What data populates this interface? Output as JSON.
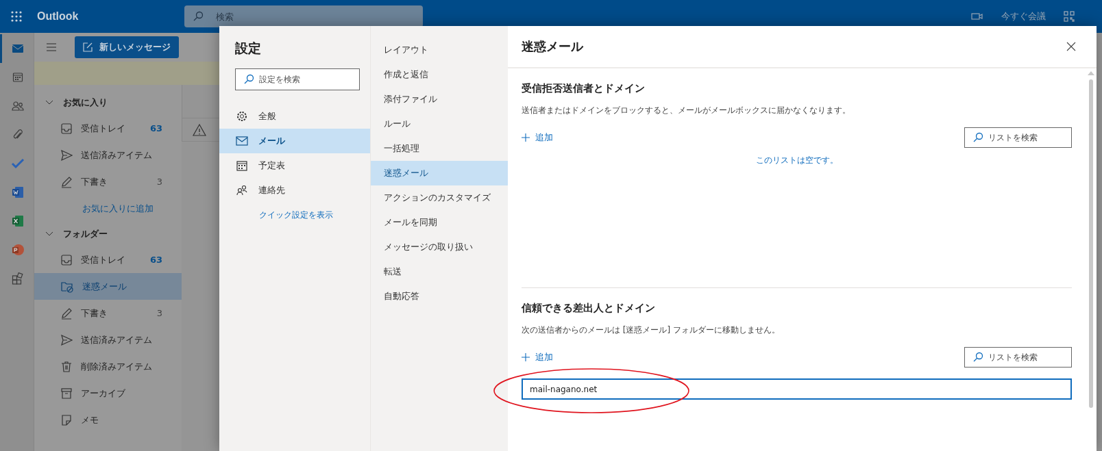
{
  "topbar": {
    "app_name": "Outlook",
    "search_placeholder": "検索",
    "meet_now": "今すぐ会議"
  },
  "rail": [
    {
      "kind": "mail",
      "selected": true
    },
    {
      "kind": "calendar",
      "selected": false
    },
    {
      "kind": "people",
      "selected": false
    },
    {
      "kind": "attach",
      "selected": false
    },
    {
      "kind": "todo",
      "selected": false
    },
    {
      "kind": "word",
      "selected": false
    },
    {
      "kind": "excel",
      "selected": false
    },
    {
      "kind": "powerpoint",
      "selected": false
    },
    {
      "kind": "apps",
      "selected": false
    }
  ],
  "new_message": "新しいメッセージ",
  "folder_groups": [
    {
      "title": "お気に入り",
      "expanded": true,
      "items": [
        {
          "kind": "inbox",
          "label": "受信トレイ",
          "count": "63",
          "unread": true,
          "selected": false
        },
        {
          "kind": "sent",
          "label": "送信済みアイテム",
          "selected": false
        },
        {
          "kind": "drafts",
          "label": "下書き",
          "count": "3",
          "unread": false,
          "selected": false
        },
        {
          "kind": "link",
          "label": "お気に入りに追加",
          "selected": false
        }
      ]
    },
    {
      "title": "フォルダー",
      "expanded": true,
      "items": [
        {
          "kind": "inbox",
          "label": "受信トレイ",
          "count": "63",
          "unread": true,
          "selected": false
        },
        {
          "kind": "junk",
          "label": "迷惑メール",
          "selected": true
        },
        {
          "kind": "drafts",
          "label": "下書き",
          "count": "3",
          "unread": false,
          "selected": false
        },
        {
          "kind": "sent",
          "label": "送信済みアイテム",
          "selected": false
        },
        {
          "kind": "deleted",
          "label": "削除済みアイテム",
          "selected": false
        },
        {
          "kind": "archive",
          "label": "アーカイブ",
          "selected": false
        },
        {
          "kind": "notes",
          "label": "メモ",
          "selected": false
        }
      ]
    }
  ],
  "settings": {
    "title": "設定",
    "search_placeholder": "設定を検索",
    "categories": [
      {
        "kind": "general",
        "label": "全般",
        "selected": false
      },
      {
        "kind": "mail",
        "label": "メール",
        "selected": true
      },
      {
        "kind": "calendar",
        "label": "予定表",
        "selected": false
      },
      {
        "kind": "people",
        "label": "連絡先",
        "selected": false
      }
    ],
    "quick_settings_link": "クイック設定を表示",
    "subcategories": [
      {
        "label": "レイアウト",
        "selected": false
      },
      {
        "label": "作成と返信",
        "selected": false
      },
      {
        "label": "添付ファイル",
        "selected": false
      },
      {
        "label": "ルール",
        "selected": false
      },
      {
        "label": "一括処理",
        "selected": false
      },
      {
        "label": "迷惑メール",
        "selected": true
      },
      {
        "label": "アクションのカスタマイズ",
        "selected": false
      },
      {
        "label": "メールを同期",
        "selected": false
      },
      {
        "label": "メッセージの取り扱い",
        "selected": false
      },
      {
        "label": "転送",
        "selected": false
      },
      {
        "label": "自動応答",
        "selected": false
      }
    ],
    "pane_title": "迷惑メール",
    "sections": [
      {
        "title": "受信拒否送信者とドメイン",
        "description": "送信者またはドメインをブロックすると、メールがメールボックスに届かなくなります。",
        "add_label": "追加",
        "search_placeholder": "リストを検索",
        "empty_message": "このリストは空です。"
      },
      {
        "title": "信頼できる差出人とドメイン",
        "description": "次の送信者からのメールは [迷惑メール] フォルダーに移動しません。",
        "add_label": "追加",
        "search_placeholder": "リストを検索",
        "entry_value": "mail-nagano.net"
      }
    ]
  }
}
